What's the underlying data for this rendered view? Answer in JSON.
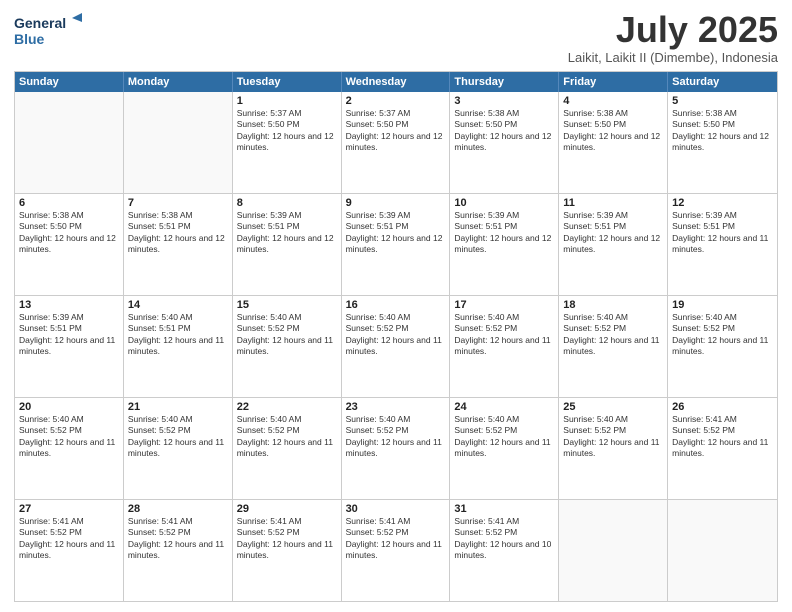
{
  "logo": {
    "line1": "General",
    "line2": "Blue"
  },
  "title": "July 2025",
  "subtitle": "Laikit, Laikit II (Dimembe), Indonesia",
  "header_days": [
    "Sunday",
    "Monday",
    "Tuesday",
    "Wednesday",
    "Thursday",
    "Friday",
    "Saturday"
  ],
  "weeks": [
    [
      {
        "day": "",
        "sunrise": "",
        "sunset": "",
        "daylight": ""
      },
      {
        "day": "",
        "sunrise": "",
        "sunset": "",
        "daylight": ""
      },
      {
        "day": "1",
        "sunrise": "Sunrise: 5:37 AM",
        "sunset": "Sunset: 5:50 PM",
        "daylight": "Daylight: 12 hours and 12 minutes."
      },
      {
        "day": "2",
        "sunrise": "Sunrise: 5:37 AM",
        "sunset": "Sunset: 5:50 PM",
        "daylight": "Daylight: 12 hours and 12 minutes."
      },
      {
        "day": "3",
        "sunrise": "Sunrise: 5:38 AM",
        "sunset": "Sunset: 5:50 PM",
        "daylight": "Daylight: 12 hours and 12 minutes."
      },
      {
        "day": "4",
        "sunrise": "Sunrise: 5:38 AM",
        "sunset": "Sunset: 5:50 PM",
        "daylight": "Daylight: 12 hours and 12 minutes."
      },
      {
        "day": "5",
        "sunrise": "Sunrise: 5:38 AM",
        "sunset": "Sunset: 5:50 PM",
        "daylight": "Daylight: 12 hours and 12 minutes."
      }
    ],
    [
      {
        "day": "6",
        "sunrise": "Sunrise: 5:38 AM",
        "sunset": "Sunset: 5:50 PM",
        "daylight": "Daylight: 12 hours and 12 minutes."
      },
      {
        "day": "7",
        "sunrise": "Sunrise: 5:38 AM",
        "sunset": "Sunset: 5:51 PM",
        "daylight": "Daylight: 12 hours and 12 minutes."
      },
      {
        "day": "8",
        "sunrise": "Sunrise: 5:39 AM",
        "sunset": "Sunset: 5:51 PM",
        "daylight": "Daylight: 12 hours and 12 minutes."
      },
      {
        "day": "9",
        "sunrise": "Sunrise: 5:39 AM",
        "sunset": "Sunset: 5:51 PM",
        "daylight": "Daylight: 12 hours and 12 minutes."
      },
      {
        "day": "10",
        "sunrise": "Sunrise: 5:39 AM",
        "sunset": "Sunset: 5:51 PM",
        "daylight": "Daylight: 12 hours and 12 minutes."
      },
      {
        "day": "11",
        "sunrise": "Sunrise: 5:39 AM",
        "sunset": "Sunset: 5:51 PM",
        "daylight": "Daylight: 12 hours and 12 minutes."
      },
      {
        "day": "12",
        "sunrise": "Sunrise: 5:39 AM",
        "sunset": "Sunset: 5:51 PM",
        "daylight": "Daylight: 12 hours and 11 minutes."
      }
    ],
    [
      {
        "day": "13",
        "sunrise": "Sunrise: 5:39 AM",
        "sunset": "Sunset: 5:51 PM",
        "daylight": "Daylight: 12 hours and 11 minutes."
      },
      {
        "day": "14",
        "sunrise": "Sunrise: 5:40 AM",
        "sunset": "Sunset: 5:51 PM",
        "daylight": "Daylight: 12 hours and 11 minutes."
      },
      {
        "day": "15",
        "sunrise": "Sunrise: 5:40 AM",
        "sunset": "Sunset: 5:52 PM",
        "daylight": "Daylight: 12 hours and 11 minutes."
      },
      {
        "day": "16",
        "sunrise": "Sunrise: 5:40 AM",
        "sunset": "Sunset: 5:52 PM",
        "daylight": "Daylight: 12 hours and 11 minutes."
      },
      {
        "day": "17",
        "sunrise": "Sunrise: 5:40 AM",
        "sunset": "Sunset: 5:52 PM",
        "daylight": "Daylight: 12 hours and 11 minutes."
      },
      {
        "day": "18",
        "sunrise": "Sunrise: 5:40 AM",
        "sunset": "Sunset: 5:52 PM",
        "daylight": "Daylight: 12 hours and 11 minutes."
      },
      {
        "day": "19",
        "sunrise": "Sunrise: 5:40 AM",
        "sunset": "Sunset: 5:52 PM",
        "daylight": "Daylight: 12 hours and 11 minutes."
      }
    ],
    [
      {
        "day": "20",
        "sunrise": "Sunrise: 5:40 AM",
        "sunset": "Sunset: 5:52 PM",
        "daylight": "Daylight: 12 hours and 11 minutes."
      },
      {
        "day": "21",
        "sunrise": "Sunrise: 5:40 AM",
        "sunset": "Sunset: 5:52 PM",
        "daylight": "Daylight: 12 hours and 11 minutes."
      },
      {
        "day": "22",
        "sunrise": "Sunrise: 5:40 AM",
        "sunset": "Sunset: 5:52 PM",
        "daylight": "Daylight: 12 hours and 11 minutes."
      },
      {
        "day": "23",
        "sunrise": "Sunrise: 5:40 AM",
        "sunset": "Sunset: 5:52 PM",
        "daylight": "Daylight: 12 hours and 11 minutes."
      },
      {
        "day": "24",
        "sunrise": "Sunrise: 5:40 AM",
        "sunset": "Sunset: 5:52 PM",
        "daylight": "Daylight: 12 hours and 11 minutes."
      },
      {
        "day": "25",
        "sunrise": "Sunrise: 5:40 AM",
        "sunset": "Sunset: 5:52 PM",
        "daylight": "Daylight: 12 hours and 11 minutes."
      },
      {
        "day": "26",
        "sunrise": "Sunrise: 5:41 AM",
        "sunset": "Sunset: 5:52 PM",
        "daylight": "Daylight: 12 hours and 11 minutes."
      }
    ],
    [
      {
        "day": "27",
        "sunrise": "Sunrise: 5:41 AM",
        "sunset": "Sunset: 5:52 PM",
        "daylight": "Daylight: 12 hours and 11 minutes."
      },
      {
        "day": "28",
        "sunrise": "Sunrise: 5:41 AM",
        "sunset": "Sunset: 5:52 PM",
        "daylight": "Daylight: 12 hours and 11 minutes."
      },
      {
        "day": "29",
        "sunrise": "Sunrise: 5:41 AM",
        "sunset": "Sunset: 5:52 PM",
        "daylight": "Daylight: 12 hours and 11 minutes."
      },
      {
        "day": "30",
        "sunrise": "Sunrise: 5:41 AM",
        "sunset": "Sunset: 5:52 PM",
        "daylight": "Daylight: 12 hours and 11 minutes."
      },
      {
        "day": "31",
        "sunrise": "Sunrise: 5:41 AM",
        "sunset": "Sunset: 5:52 PM",
        "daylight": "Daylight: 12 hours and 10 minutes."
      },
      {
        "day": "",
        "sunrise": "",
        "sunset": "",
        "daylight": ""
      },
      {
        "day": "",
        "sunrise": "",
        "sunset": "",
        "daylight": ""
      }
    ]
  ]
}
